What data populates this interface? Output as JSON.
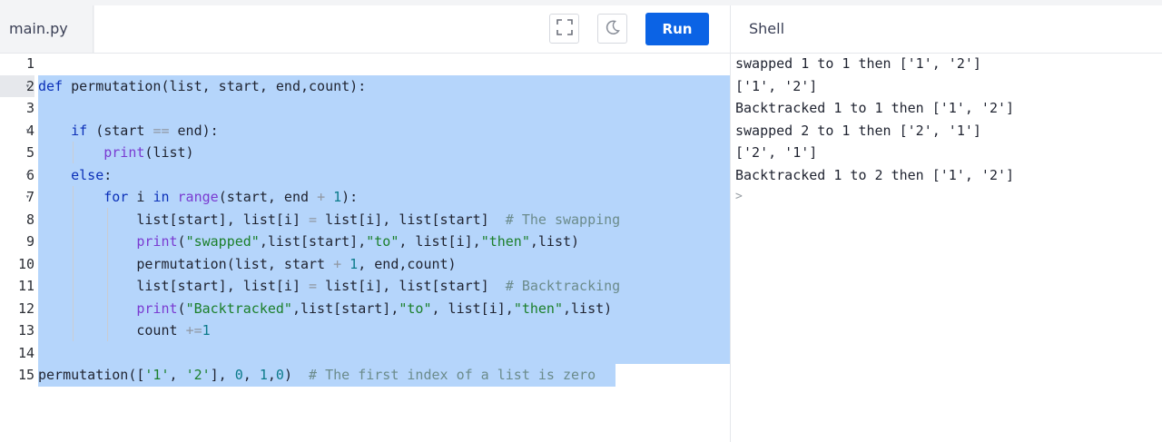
{
  "editor": {
    "file_tab": "main.py",
    "run_label": "Run",
    "fullscreen_icon": "fullscreen-icon",
    "theme_icon": "moon-icon",
    "lines": [
      {
        "n": "1"
      },
      {
        "n": "2"
      },
      {
        "n": "3"
      },
      {
        "n": "4"
      },
      {
        "n": "5"
      },
      {
        "n": "6"
      },
      {
        "n": "7"
      },
      {
        "n": "8"
      },
      {
        "n": "9"
      },
      {
        "n": "10"
      },
      {
        "n": "11"
      },
      {
        "n": "12"
      },
      {
        "n": "13"
      },
      {
        "n": "14"
      },
      {
        "n": "15"
      }
    ],
    "fold_glyph": "▾"
  },
  "shell": {
    "title": "Shell",
    "output": [
      "swapped 1 to 1 then ['1', '2']",
      "['1', '2']",
      "Backtracked 1 to 1 then ['1', '2']",
      "swapped 2 to 1 then ['2', '1']",
      "['2', '1']",
      "Backtracked 1 to 2 then ['1', '2']"
    ],
    "prompt": ">"
  },
  "colors": {
    "accent": "#0b63e5",
    "selection": "#b5d5fb",
    "keyword": "#0b30b8",
    "string": "#1b7f2a",
    "comment": "#6b8b8b",
    "builtin": "#7a3bd1"
  }
}
